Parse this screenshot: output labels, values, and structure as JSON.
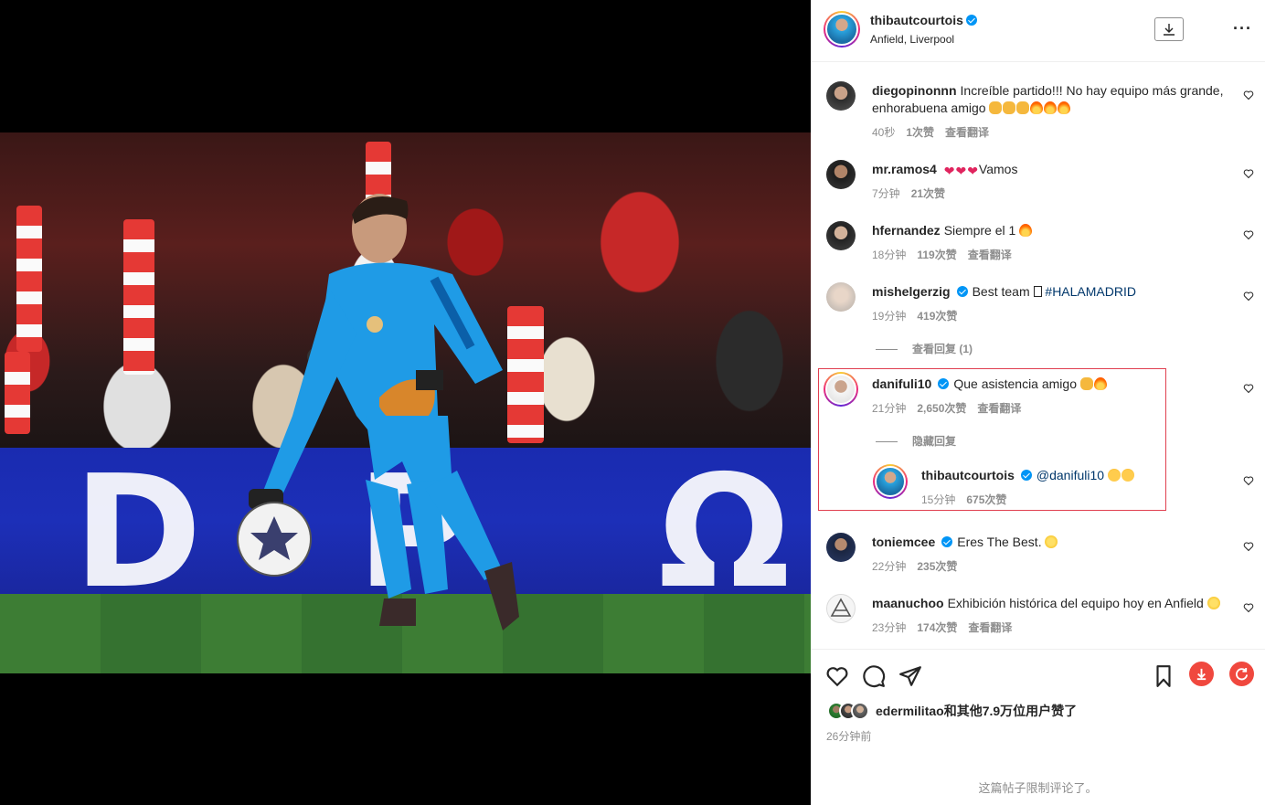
{
  "post": {
    "author": "thibautcourtois",
    "location": "Anfield, Liverpool",
    "verified": true
  },
  "icons": {
    "download": "download-icon",
    "more": "more-options-icon",
    "like": "heart-icon",
    "comment": "comment-icon",
    "share": "share-icon",
    "save": "bookmark-icon",
    "ext_download": "red-download-icon",
    "ext_refresh": "red-refresh-icon"
  },
  "colors": {
    "verified": "#0095f6",
    "highlight_border": "#e04050",
    "ext_buttons": "#f0483e",
    "muted_text": "#8e8e8e"
  },
  "comments": [
    {
      "user": "diegopinonnn",
      "verified": false,
      "text": "Increíble partido!!! No hay equipo más grande, enhorabuena amigo",
      "time": "40秒",
      "likes": "1次赞",
      "translate": "查看翻译"
    },
    {
      "user": "mr.ramos4",
      "verified": false,
      "text": "Vamos",
      "time": "7分钟",
      "likes": "21次赞"
    },
    {
      "user": "hfernandez",
      "verified": false,
      "text": "Siempre el 1",
      "time": "18分钟",
      "likes": "119次赞",
      "translate": "查看翻译"
    },
    {
      "user": "mishelgerzig",
      "verified": true,
      "text": "Best team",
      "hashtag": "#HALAMADRID",
      "time": "19分钟",
      "likes": "419次赞",
      "replies": "查看回复 (1)"
    },
    {
      "user": "danifuli10",
      "verified": true,
      "text": "Que asistencia amigo",
      "time": "21分钟",
      "likes": "2,650次赞",
      "translate": "查看翻译",
      "replies": "隐藏回复",
      "reply": {
        "user": "thibautcourtois",
        "verified": true,
        "text": "@danifuli10",
        "time": "15分钟",
        "likes": "675次赞"
      }
    },
    {
      "user": "toniemcee",
      "verified": true,
      "text": "Eres The Best.",
      "time": "22分钟",
      "likes": "235次赞"
    },
    {
      "user": "maanuchoo",
      "verified": false,
      "text": "Exhibición histórica del equipo hoy en Anfield",
      "time": "23分钟",
      "likes": "174次赞",
      "translate": "查看翻译"
    }
  ],
  "likes_summary": "edermilitao和其他7.9万位用户赞了",
  "post_time": "26分钟前",
  "comments_limited": "这篇帖子限制评论了。"
}
